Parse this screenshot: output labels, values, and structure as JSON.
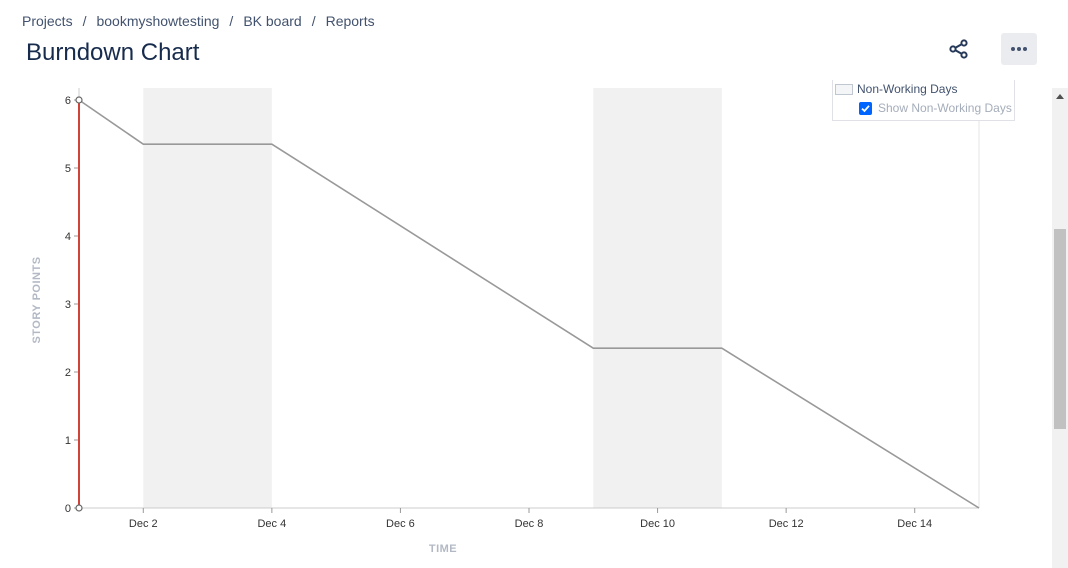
{
  "breadcrumb": {
    "items": [
      "Projects",
      "bookmyshowtesting",
      "BK board",
      "Reports"
    ],
    "separator": "/"
  },
  "page": {
    "title": "Burndown Chart"
  },
  "toolbar": {
    "share_icon": "share-icon",
    "more_icon": "more-icon",
    "more_label": "•••"
  },
  "legend": {
    "non_working_days_label": "Non-Working Days",
    "show_non_working_days_label": "Show Non-Working Days",
    "show_non_working_days_checked": true
  },
  "chart_data": {
    "type": "line",
    "xlabel": "TIME",
    "ylabel": "STORY POINTS",
    "x_range": [
      "Dec 1",
      "Dec 15"
    ],
    "ylim": [
      0,
      6
    ],
    "x_ticks": [
      "Dec 2",
      "Dec 4",
      "Dec 6",
      "Dec 8",
      "Dec 10",
      "Dec 12",
      "Dec 14"
    ],
    "y_ticks": [
      "0",
      "1",
      "2",
      "3",
      "4",
      "5",
      "6"
    ],
    "non_working_days": [
      {
        "start": "Dec 2",
        "end": "Dec 4"
      },
      {
        "start": "Dec 9",
        "end": "Dec 11"
      }
    ],
    "series": [
      {
        "role": "guideline",
        "color": "#999999",
        "points": [
          {
            "x": "Dec 1",
            "y": 6.0
          },
          {
            "x": "Dec 2",
            "y": 5.35
          },
          {
            "x": "Dec 4",
            "y": 5.35
          },
          {
            "x": "Dec 9",
            "y": 2.35
          },
          {
            "x": "Dec 11",
            "y": 2.35
          },
          {
            "x": "Dec 15",
            "y": 0
          }
        ]
      },
      {
        "role": "remaining",
        "color": "#d04437",
        "points": [
          {
            "x": "Dec 1",
            "y": 0
          },
          {
            "x": "Dec 1",
            "y": 6.0
          }
        ]
      }
    ],
    "grid": false
  }
}
